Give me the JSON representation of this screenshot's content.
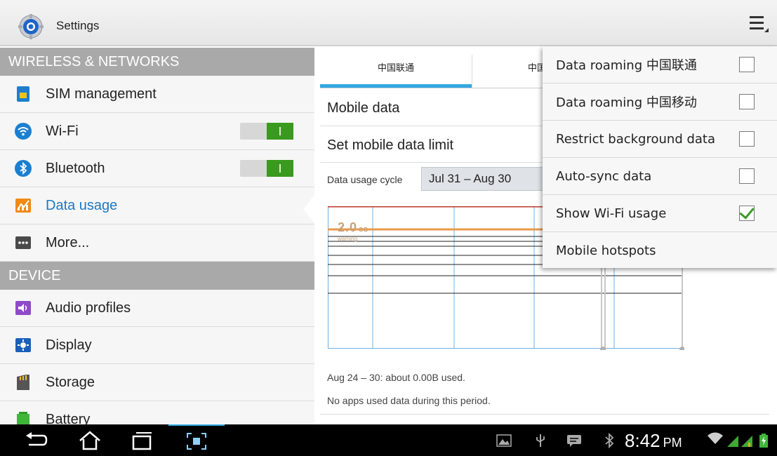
{
  "app": {
    "title": "Settings",
    "icon": "settings-gear-icon"
  },
  "left_panel": {
    "sections": [
      {
        "header": "WIRELESS & NETWORKS"
      },
      {
        "header": "DEVICE"
      }
    ],
    "wireless_items": [
      {
        "label": "SIM management",
        "icon": "sim-card-icon"
      },
      {
        "label": "Wi-Fi",
        "icon": "wifi-icon",
        "toggle": "on"
      },
      {
        "label": "Bluetooth",
        "icon": "bluetooth-icon",
        "toggle": "on"
      },
      {
        "label": "Data usage",
        "icon": "data-usage-icon",
        "selected": true
      },
      {
        "label": "More...",
        "icon": "more-icon"
      }
    ],
    "device_items": [
      {
        "label": "Audio profiles",
        "icon": "audio-profiles-icon"
      },
      {
        "label": "Display",
        "icon": "display-icon"
      },
      {
        "label": "Storage",
        "icon": "storage-icon"
      },
      {
        "label": "Battery",
        "icon": "battery-icon"
      }
    ]
  },
  "data_usage": {
    "tabs": [
      "中国联通",
      "中国移动"
    ],
    "mobile_data_label": "Mobile data",
    "set_limit_label": "Set mobile data limit",
    "cycle_label": "Data usage cycle",
    "cycle_value": "Jul 31 – Aug 30",
    "chart_warning_value": "2.0",
    "chart_warning_unit": "GB",
    "chart_warning_label": "warning",
    "summary_line1": "Aug 24 – 30: about 0.00B used.",
    "summary_line2": "No apps used data during this period."
  },
  "overflow_menu": {
    "items": [
      {
        "label": "Data roaming 中国联通",
        "checked": false
      },
      {
        "label": "Data roaming 中国移动",
        "checked": false
      },
      {
        "label": "Restrict background data",
        "checked": false
      },
      {
        "label": "Auto-sync data",
        "checked": false
      },
      {
        "label": "Show Wi-Fi usage",
        "checked": true
      },
      {
        "label": "Mobile hotspots"
      }
    ]
  },
  "system_bar": {
    "time": "8:42",
    "ampm": "PM",
    "nav_buttons": [
      "back-icon",
      "home-icon",
      "recent-apps-icon",
      "screenshot-icon"
    ],
    "status_icons": [
      "gallery-notification-icon",
      "usb-icon",
      "message-icon",
      "bluetooth-status-icon",
      "wifi-signal-icon",
      "cell-signal-icon",
      "battery-charging-icon"
    ]
  },
  "colors": {
    "accent": "#33a8e0",
    "selected_text": "#1b79c4",
    "section_header": "#a9a9a9",
    "toggle_on": "#3a9a1f",
    "warning_line": "#e89a4a",
    "limit_line": "#c0392b"
  }
}
